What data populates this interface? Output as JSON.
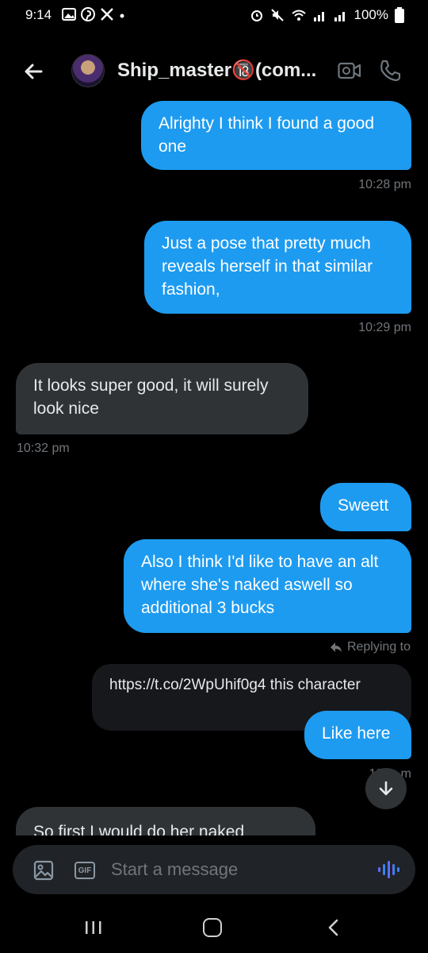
{
  "status_bar": {
    "time": "9:14",
    "battery": "100%"
  },
  "header": {
    "title": "Ship_master🔞(com...",
    "accent": "#1d9bf0"
  },
  "messages": [
    {
      "type": "sent",
      "text": "Alrighty I think I found a good one",
      "time": "10:28 pm"
    },
    {
      "type": "sent",
      "text": "Just a pose that pretty much reveals herself in that similar fashion,",
      "time": "10:29 pm"
    },
    {
      "type": "received",
      "text": "It looks super good, it will surely look nice",
      "time": "10:32 pm"
    },
    {
      "type": "sent",
      "text": "Sweett"
    },
    {
      "type": "sent",
      "text": "Also I think I'd like to have an alt where she's naked aswell so additional 3 bucks"
    },
    {
      "type": "reply_label",
      "text": "Replying to"
    },
    {
      "type": "quoted",
      "text": "https://t.co/2WpUhif0g4 this character"
    },
    {
      "type": "sent",
      "text": "Like here",
      "time": "10:__m"
    },
    {
      "type": "received",
      "text": "So first I would do her naked"
    }
  ],
  "composer": {
    "placeholder": "Start a message",
    "gif_label": "GIF"
  },
  "icons": {
    "back": "arrow-left-icon",
    "video": "video-camera-icon",
    "call": "phone-icon",
    "image": "image-icon",
    "voice": "waveform-icon",
    "scroll": "arrow-down-icon"
  }
}
